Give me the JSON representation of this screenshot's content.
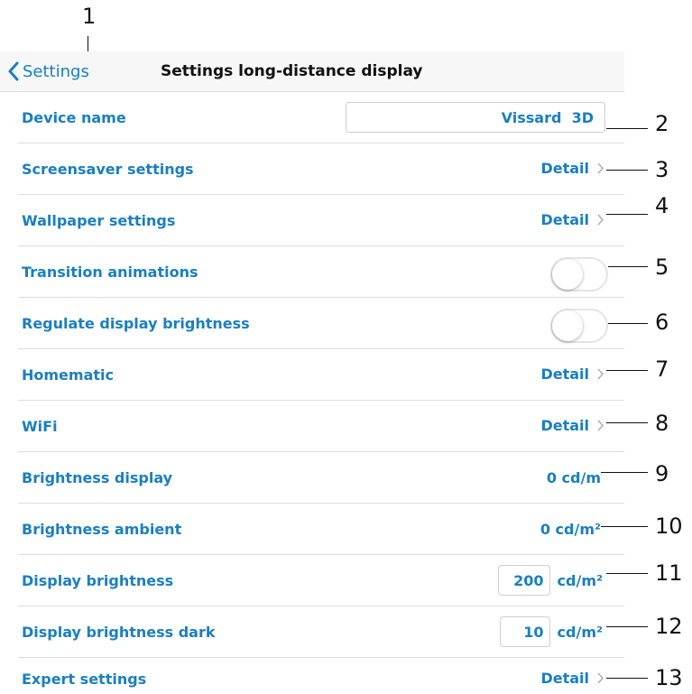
{
  "callouts": [
    "1",
    "2",
    "3",
    "4",
    "5",
    "6",
    "7",
    "8",
    "9",
    "10",
    "11",
    "12",
    "13"
  ],
  "navbar": {
    "back_label": "Settings",
    "title": "Settings long-distance display"
  },
  "rows": [
    {
      "label": "Device name",
      "value": "Vissard  3D"
    },
    {
      "label": "Screensaver settings",
      "detail": "Detail"
    },
    {
      "label": "Wallpaper settings",
      "detail": "Detail"
    },
    {
      "label": "Transition animations",
      "toggle": false
    },
    {
      "label": "Regulate display brightness",
      "toggle": false
    },
    {
      "label": "Homematic",
      "detail": "Detail"
    },
    {
      "label": "WiFi",
      "detail": "Detail"
    },
    {
      "label": "Brightness display",
      "value": "0 cd/m"
    },
    {
      "label": "Brightness ambient",
      "value": "0 cd/m²"
    },
    {
      "label": "Display brightness",
      "value": "200",
      "unit": "cd/m²"
    },
    {
      "label": "Display brightness dark",
      "value": "10",
      "unit": "cd/m²"
    },
    {
      "label": "Expert settings",
      "detail": "Detail"
    }
  ],
  "icons": {
    "back": "chevron-left-icon",
    "disclosure": "chevron-right-icon"
  },
  "colors": {
    "accent": "#1a7fc0",
    "navbar_bg": "#f7f7f7",
    "separator": "#dedede"
  }
}
